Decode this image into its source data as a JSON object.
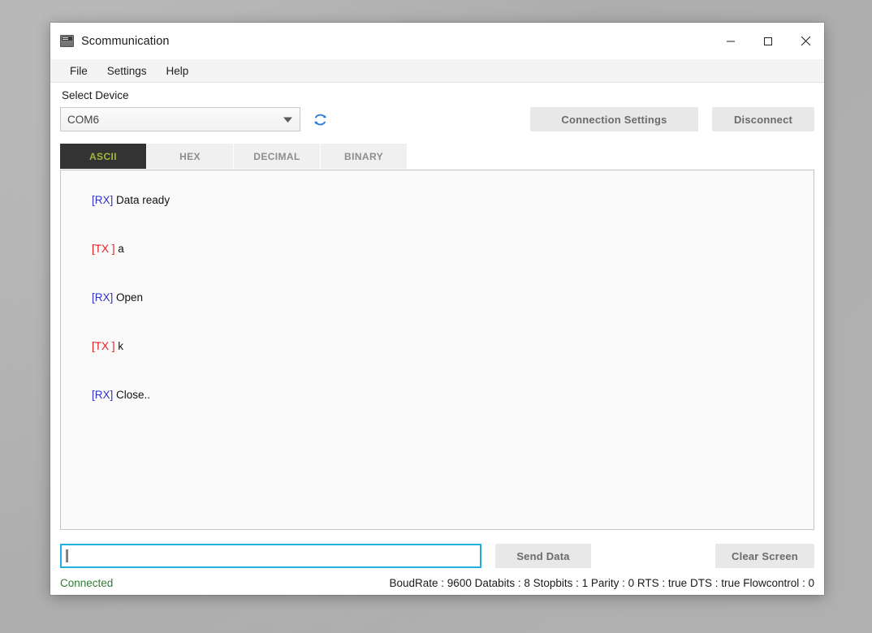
{
  "window": {
    "title": "Scommunication",
    "icon": "serial-monitor-icon",
    "controls": {
      "minimize": "minimize-icon",
      "maximize": "maximize-icon",
      "close": "close-icon"
    }
  },
  "menubar": {
    "items": [
      {
        "label": "File"
      },
      {
        "label": "Settings"
      },
      {
        "label": "Help"
      }
    ]
  },
  "device": {
    "label": "Select Device",
    "selected": "COM6",
    "options": [
      "COM6"
    ],
    "refresh_icon": "refresh-icon"
  },
  "toolbar": {
    "connection_settings_label": "Connection Settings",
    "disconnect_label": "Disconnect"
  },
  "tabs": [
    {
      "label": "ASCII",
      "active": true
    },
    {
      "label": "HEX",
      "active": false
    },
    {
      "label": "DECIMAL",
      "active": false
    },
    {
      "label": "BINARY",
      "active": false
    }
  ],
  "log": {
    "lines": [
      {
        "tag": "[RX]",
        "dir": "rx",
        "text": " Data ready"
      },
      {
        "tag": "[TX ]",
        "dir": "tx",
        "text": " a"
      },
      {
        "tag": "[RX]",
        "dir": "rx",
        "text": " Open"
      },
      {
        "tag": "[TX ]",
        "dir": "tx",
        "text": " k"
      },
      {
        "tag": "[RX]",
        "dir": "rx",
        "text": " Close.."
      }
    ]
  },
  "send": {
    "input_value": "",
    "input_placeholder": "",
    "send_label": "Send Data",
    "clear_label": "Clear Screen"
  },
  "status": {
    "connection": "Connected",
    "params": "BoudRate : 9600 Databits : 8 Stopbits : 1 Parity : 0 RTS : true DTS : true Flowcontrol : 0"
  },
  "colors": {
    "accent_tab_text": "#a0b838",
    "tab_active_bg": "#333333",
    "rx_tag": "#2f2fd0",
    "tx_tag": "#e02020",
    "connected": "#2e7d32",
    "input_focus": "#22b0e0",
    "refresh": "#2b7cd3"
  }
}
